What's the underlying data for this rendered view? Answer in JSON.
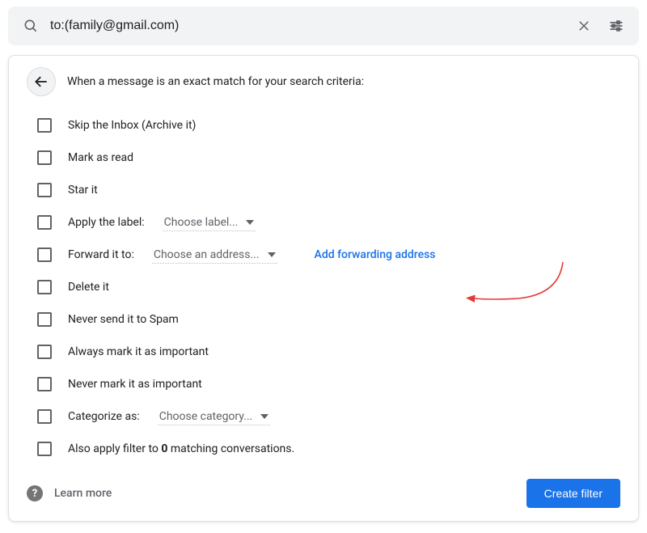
{
  "search": {
    "value": "to:(family@gmail.com)"
  },
  "panel": {
    "heading": "When a message is an exact match for your search criteria:"
  },
  "options": {
    "skip_inbox": "Skip the Inbox (Archive it)",
    "mark_read": "Mark as read",
    "star": "Star it",
    "apply_label": "Apply the label:",
    "apply_label_dd": "Choose label...",
    "forward_to": "Forward it to:",
    "forward_dd": "Choose an address...",
    "add_fwd_link": "Add forwarding address",
    "delete": "Delete it",
    "never_spam": "Never send it to Spam",
    "always_important": "Always mark it as important",
    "never_important": "Never mark it as important",
    "categorize": "Categorize as:",
    "categorize_dd": "Choose category...",
    "also_apply_pre": "Also apply filter to ",
    "also_apply_count": "0",
    "also_apply_post": " matching conversations."
  },
  "footer": {
    "learn_more": "Learn more",
    "create": "Create filter"
  }
}
